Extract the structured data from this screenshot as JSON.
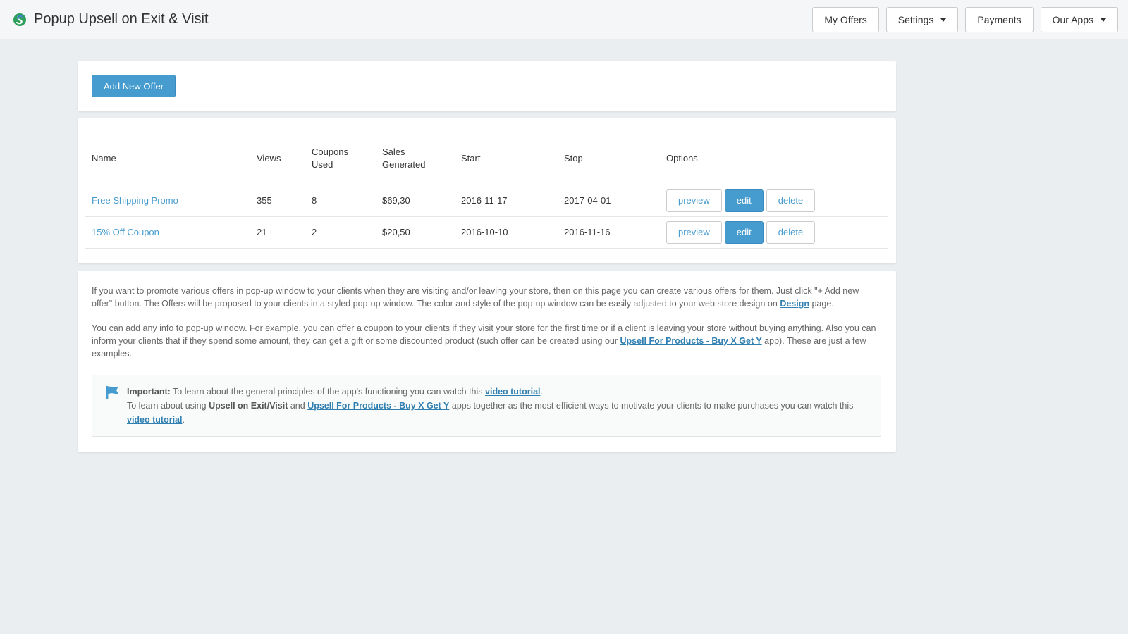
{
  "header": {
    "title": "Popup Upsell on Exit & Visit",
    "nav": {
      "my_offers": "My Offers",
      "settings": "Settings",
      "payments": "Payments",
      "our_apps": "Our Apps"
    }
  },
  "toolbar": {
    "add_offer_label": "Add New Offer"
  },
  "table": {
    "headers": {
      "name": "Name",
      "views": "Views",
      "coupons_used": "Coupons Used",
      "sales_generated": "Sales Generated",
      "start": "Start",
      "stop": "Stop",
      "options": "Options"
    },
    "rows": [
      {
        "name": "Free Shipping Promo",
        "views": "355",
        "coupons": "8",
        "sales": "$69,30",
        "start": "2016-11-17",
        "stop": "2017-04-01"
      },
      {
        "name": "15% Off Coupon",
        "views": "21",
        "coupons": "2",
        "sales": "$20,50",
        "start": "2016-10-10",
        "stop": "2016-11-16"
      }
    ],
    "actions": {
      "preview": "preview",
      "edit": "edit",
      "delete": "delete"
    }
  },
  "info": {
    "p1_before": "If you want to promote various offers in pop-up window to your clients when they are visiting and/or leaving your store, then on this page you can create various offers for them. Just click \"+ Add new offer\" button. The Offers will be proposed to your clients in a styled pop-up window. The color and style of the pop-up window can be easily adjusted to your web store design on ",
    "p1_link": "Design",
    "p1_after": " page.",
    "p2_before": "You can add any info to pop-up window. For example, you can offer a coupon to your clients if they visit your store for the first time or if a client is leaving your store without buying anything. Also you can inform your clients that if they spend some amount, they can get a gift or some discounted product (such offer can be created using our ",
    "p2_link": "Upsell For Products - Buy X Get Y",
    "p2_after": " app). These are just a few examples."
  },
  "notice": {
    "important_label": "Important:",
    "line1_text": " To learn about the general principles of the app's functioning you can watch this ",
    "line1_link": "video tutorial",
    "line1_end": ".",
    "line2_start": "To learn about using ",
    "line2_bold": "Upsell on Exit/Visit",
    "line2_and": " and ",
    "line2_link": "Upsell For Products - Buy X Get Y",
    "line2_mid": " apps together as the most efficient ways to motivate your clients to make purchases you can watch this ",
    "line2_link2": "video tutorial",
    "line2_end": "."
  },
  "colors": {
    "accent": "#479ccf",
    "link": "#2f7fb0",
    "background": "#ebeef0"
  }
}
